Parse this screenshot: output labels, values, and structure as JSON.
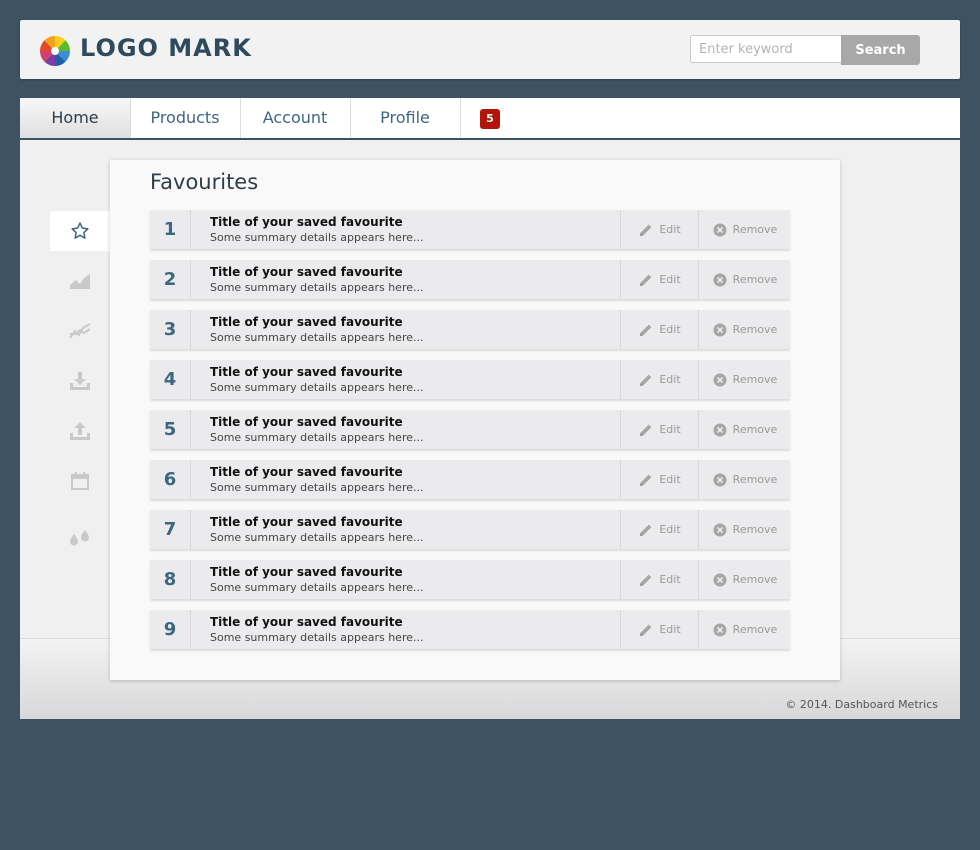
{
  "header": {
    "logo_text": "LOGO MARK",
    "logo_icon": "color-wheel-icon",
    "search_placeholder": "Enter keyword",
    "search_value": "",
    "search_button": "Search"
  },
  "nav": {
    "tabs": [
      {
        "label": "Home",
        "active": true
      },
      {
        "label": "Products",
        "active": false
      },
      {
        "label": "Account",
        "active": false
      },
      {
        "label": "Profile",
        "active": false
      }
    ],
    "badge": "5"
  },
  "sidebar": {
    "items": [
      {
        "icon": "star-icon",
        "active": true
      },
      {
        "icon": "area-chart-icon",
        "active": false
      },
      {
        "icon": "line-chart-icon",
        "active": false
      },
      {
        "icon": "download-icon",
        "active": false
      },
      {
        "icon": "upload-icon",
        "active": false
      },
      {
        "icon": "calendar-icon",
        "active": false
      },
      {
        "icon": "drops-icon",
        "active": false
      }
    ]
  },
  "favourites": {
    "title": "Favourites",
    "edit_label": "Edit",
    "remove_label": "Remove",
    "items": [
      {
        "num": "1",
        "title": "Title of your saved favourite",
        "summary": "Some summary details appears here..."
      },
      {
        "num": "2",
        "title": "Title of your saved favourite",
        "summary": "Some summary details appears here..."
      },
      {
        "num": "3",
        "title": "Title of your saved favourite",
        "summary": "Some summary details appears here..."
      },
      {
        "num": "4",
        "title": "Title of your saved favourite",
        "summary": "Some summary details appears here..."
      },
      {
        "num": "5",
        "title": "Title of your saved favourite",
        "summary": "Some summary details appears here..."
      },
      {
        "num": "6",
        "title": "Title of your saved favourite",
        "summary": "Some summary details appears here..."
      },
      {
        "num": "7",
        "title": "Title of your saved favourite",
        "summary": "Some summary details appears here..."
      },
      {
        "num": "8",
        "title": "Title of your saved favourite",
        "summary": "Some summary details appears here..."
      },
      {
        "num": "9",
        "title": "Title of your saved favourite",
        "summary": "Some summary details appears here..."
      }
    ]
  },
  "footer": {
    "copyright": "© 2014. Dashboard Metrics"
  },
  "colors": {
    "background": "#3d5361",
    "accent": "#3d6680",
    "badge": "#b3140a"
  }
}
